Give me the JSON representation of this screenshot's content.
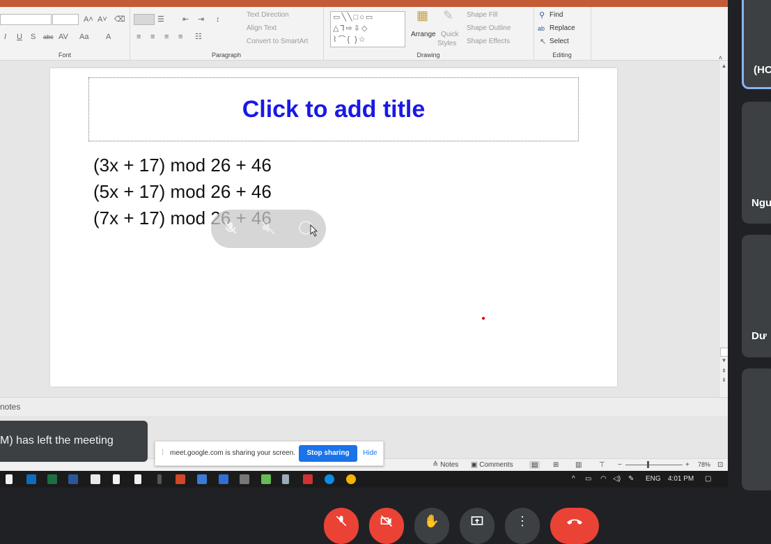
{
  "ribbon": {
    "groups": {
      "font": "Font",
      "paragraph": "Paragraph",
      "drawing": "Drawing",
      "editing": "Editing"
    },
    "paragraph_items": {
      "text_direction": "Text Direction",
      "align_text": "Align Text",
      "convert_smartart": "Convert to SmartArt"
    },
    "drawing_items": {
      "arrange": "Arrange",
      "quick_styles_1": "Quick",
      "quick_styles_2": "Styles",
      "shape_fill": "Shape Fill",
      "shape_outline": "Shape Outline",
      "shape_effects": "Shape Effects"
    },
    "editing_items": {
      "find": "Find",
      "replace": "Replace",
      "select": "Select"
    }
  },
  "slide": {
    "title_placeholder": "Click to add title",
    "lines": [
      "(3x + 17) mod 26 + 46",
      "(5x + 17) mod 26 + 46",
      "(7x + 17) mod 26 + 46"
    ]
  },
  "notes_bar": {
    "label": "notes"
  },
  "status_bar": {
    "notes": "Notes",
    "comments": "Comments",
    "zoom": "78%"
  },
  "taskbar": {
    "language": "ENG",
    "time": "4:01 PM"
  },
  "toast": {
    "text": "M) has left the meeting"
  },
  "share_bar": {
    "message": "meet.google.com is sharing your screen.",
    "stop_label": "Stop sharing",
    "hide_label": "Hide"
  },
  "participants": [
    {
      "name": "(HC"
    },
    {
      "name": "Ngu"
    },
    {
      "name": "Dư"
    },
    {
      "name": ""
    }
  ],
  "colors": {
    "title": "#1919e6",
    "accent": "#1a73e8",
    "end_call": "#ea4335"
  }
}
